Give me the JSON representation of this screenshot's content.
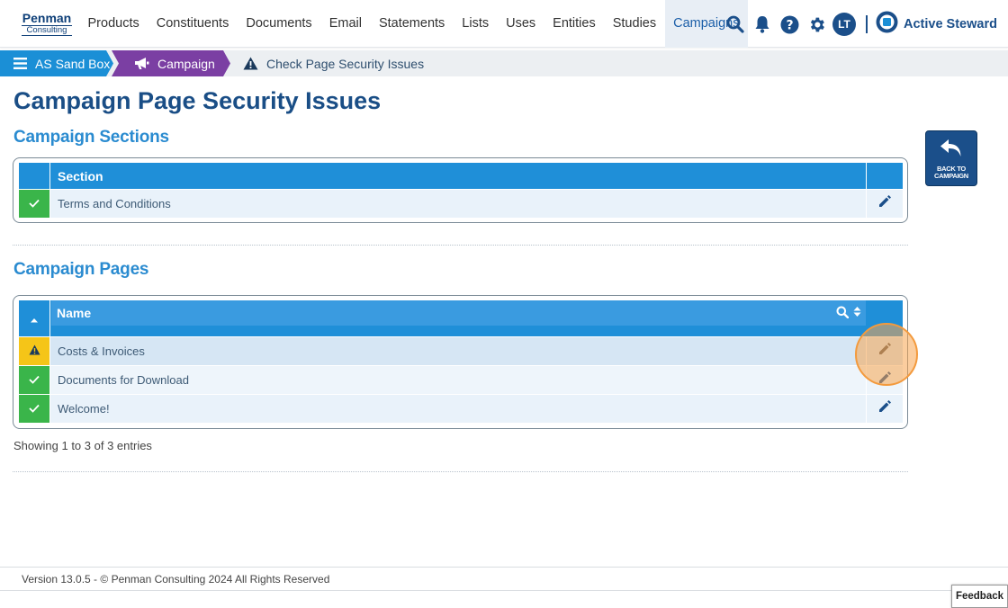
{
  "logo": {
    "line1": "Penman",
    "line2": "Consulting"
  },
  "nav": {
    "items": [
      {
        "label": "Products"
      },
      {
        "label": "Constituents"
      },
      {
        "label": "Documents"
      },
      {
        "label": "Email"
      },
      {
        "label": "Statements"
      },
      {
        "label": "Lists"
      },
      {
        "label": "Uses"
      },
      {
        "label": "Entities"
      },
      {
        "label": "Studies"
      },
      {
        "label": "Campaigns",
        "active": true
      }
    ],
    "avatar_initials": "LT",
    "brand_name": "Active Steward"
  },
  "breadcrumb": {
    "items": [
      "AS Sand Box",
      "Campaign",
      "Check Page Security Issues"
    ]
  },
  "page_title": "Campaign Page Security Issues",
  "sections_table": {
    "title": "Campaign Sections",
    "header": "Section",
    "rows": [
      {
        "name": "Terms and Conditions",
        "status": "ok"
      }
    ]
  },
  "pages_table": {
    "title": "Campaign Pages",
    "header": "Name",
    "rows": [
      {
        "name": "Costs & Invoices",
        "status": "warning"
      },
      {
        "name": "Documents for Download",
        "status": "ok"
      },
      {
        "name": "Welcome!",
        "status": "ok"
      }
    ],
    "entries_text": "Showing 1 to 3 of 3 entries"
  },
  "back_button": {
    "line1": "BACK TO",
    "line2": "CAMPAIGN"
  },
  "footer": {
    "text": "Version 13.0.5 - © Penman Consulting 2024 All Rights Reserved"
  },
  "feedback_label": "Feedback",
  "colors": {
    "primary": "#1f8fd8",
    "navy": "#1b4f8a",
    "purple": "#7b3fa3",
    "ok": "#3ab54a",
    "warning": "#f5c518"
  }
}
